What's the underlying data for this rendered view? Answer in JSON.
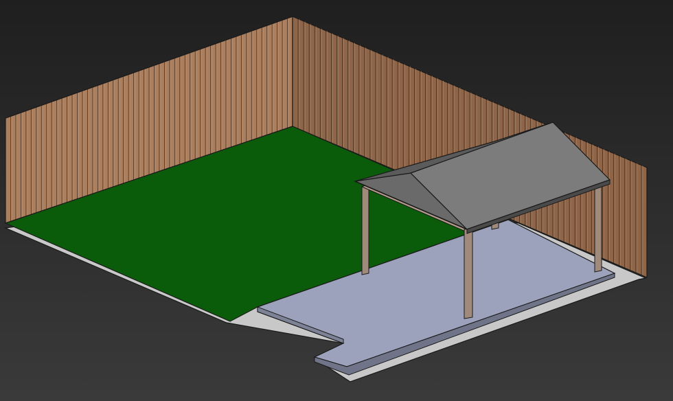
{
  "scene": {
    "description_visible_text": "",
    "colors": {
      "background_top": "#1f1f1f",
      "background_bottom": "#3a3a3a",
      "lawn": "#0a5c0a",
      "patio_slab": "#9aa0b8",
      "border_strip": "#c9c9c9",
      "fence_back_wall": "#a97d5d",
      "fence_right_wall": "#8d6447",
      "post": "#a08a7c",
      "roof_front": "#7a7a7a",
      "roof_side": "#5c5c5c",
      "outline": "#1a1a1a"
    }
  }
}
